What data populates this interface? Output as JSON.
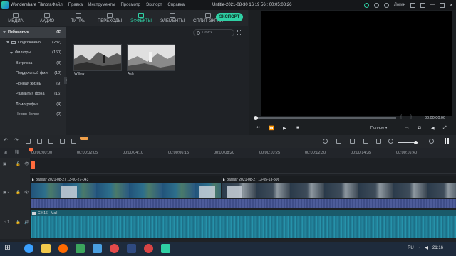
{
  "titlebar": {
    "app_name": "Wondershare Filmora",
    "menu": [
      "Файл",
      "Правка",
      "Инструменты",
      "Просмотр",
      "Экспорт",
      "Справка"
    ],
    "doc_title": "Untitle-2021-08-30 16 19 56 : 00:05:08:26",
    "login": "Логин"
  },
  "tabs": [
    {
      "label": "МЕДИА",
      "icon": "folder-icon"
    },
    {
      "label": "АУДИО",
      "icon": "music-icon"
    },
    {
      "label": "ТИТРЫ",
      "icon": "text-icon"
    },
    {
      "label": "ПЕРЕХОДЫ",
      "icon": "transition-icon"
    },
    {
      "label": "ЭФФЕКТЫ",
      "icon": "effects-icon",
      "active": true
    },
    {
      "label": "ЭЛЕМЕНТЫ",
      "icon": "elements-icon"
    },
    {
      "label": "СПЛИТ ЭКРАН",
      "icon": "split-screen-icon"
    }
  ],
  "export_label": "ЭКСПОРТ",
  "sidebar": {
    "items": [
      {
        "label": "Избранное",
        "count": "(2)"
      },
      {
        "label": "Подключено",
        "count": "(287)"
      },
      {
        "label": "Фильтры",
        "count": "(160)"
      },
      {
        "label": "Встряска",
        "count": "(8)"
      },
      {
        "label": "Поддельный фил",
        "count": "(12)"
      },
      {
        "label": "Ночная жизнь",
        "count": "(9)"
      },
      {
        "label": "Размытия фона",
        "count": "(16)"
      },
      {
        "label": "Ломография",
        "count": "(4)"
      },
      {
        "label": "Черно-белое",
        "count": "(2)"
      }
    ]
  },
  "search": {
    "placeholder": "Поиск"
  },
  "effects": [
    {
      "name": "Willow"
    },
    {
      "name": "Ash"
    }
  ],
  "preview": {
    "time": "00:00:00:00",
    "quality": "Полное"
  },
  "ruler": [
    "00:00:00:00",
    "00:00:02:05",
    "00:00:04:10",
    "00:00:06:15",
    "00:00:08:20",
    "00:00:10:25",
    "00:00:12:30",
    "00:00:14:35",
    "00:00:16:40"
  ],
  "timeline": {
    "track_labels": {
      "video": "2",
      "audio": "1"
    },
    "clip1_title": "Захват 2021-08-27 13-00-27-043",
    "clip2_title": "Захват 2021-08-27 13-05-13-506",
    "audio_title": "СЖ16 - Mail"
  },
  "taskbar": {
    "lang": "RU",
    "time": "21:16"
  }
}
